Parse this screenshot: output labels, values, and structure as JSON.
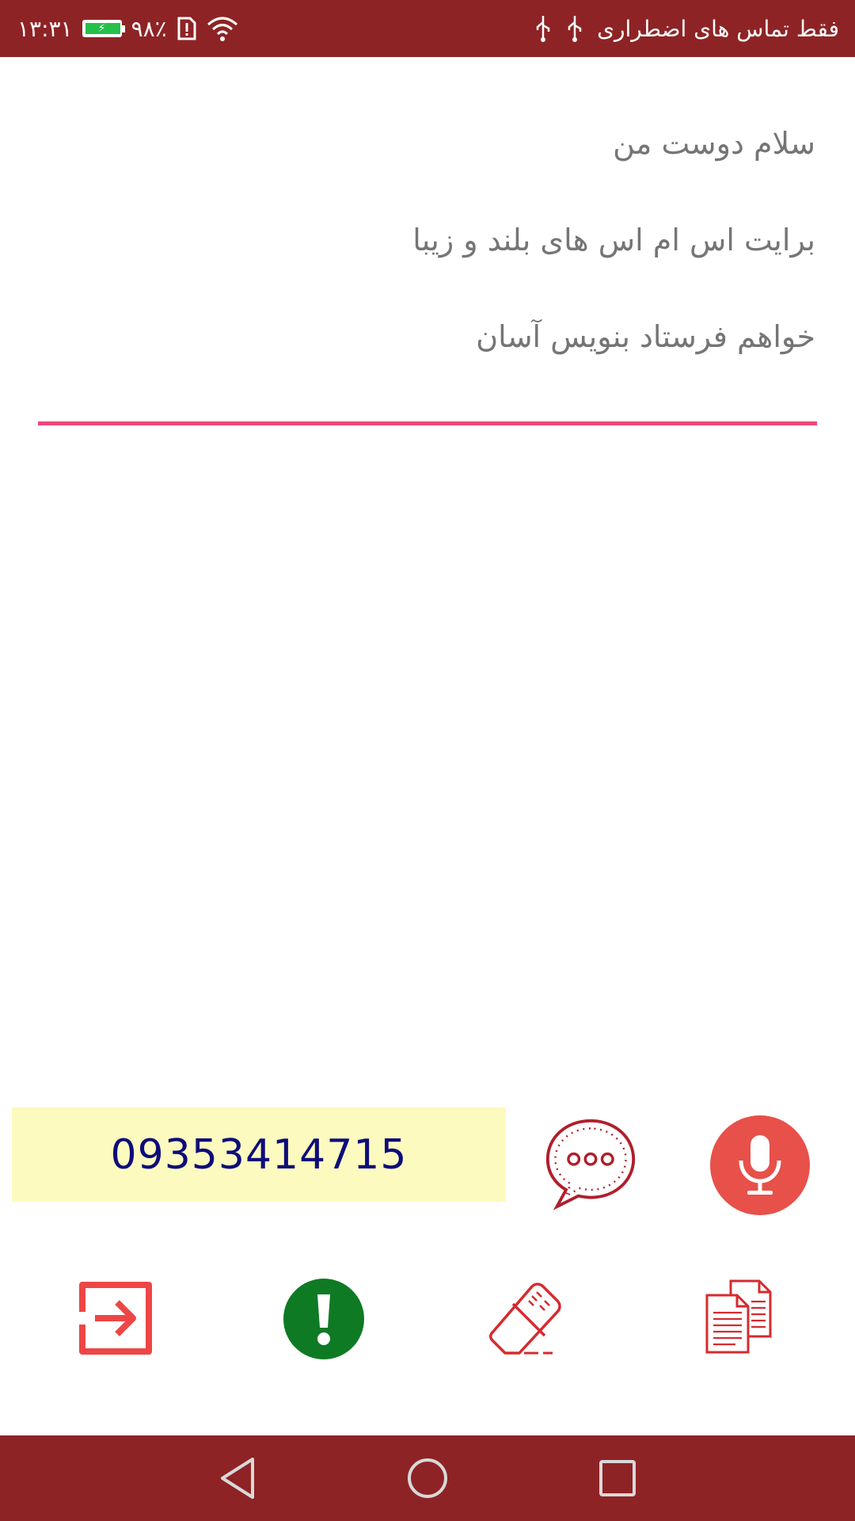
{
  "status_bar": {
    "time": "۱۳:۳۱",
    "battery_percent": "۹۸٪",
    "battery_level": 0.98,
    "carrier_text": "فقط تماس های اضطراری",
    "battery_color": "#24c04a"
  },
  "message": {
    "text": "سلام دوست من\n برایت اس ام اس های بلند و زیبا\nخواهم فرستاد  بنویس آسان"
  },
  "phone": {
    "number": "09353414715"
  },
  "icons": {
    "mic": "microphone-icon",
    "chat": "chat-bubble-icon",
    "copy": "copy-documents-icon",
    "eraser": "eraser-icon",
    "alert": "exclamation-icon",
    "exit": "exit-icon",
    "nav_back": "back-triangle-icon",
    "nav_home": "home-circle-icon",
    "nav_recent": "recent-square-icon"
  },
  "colors": {
    "bar": "#8e2325",
    "accent": "#f0467c",
    "mic_bg": "#e8504a",
    "alert_bg": "#0e7a24",
    "phone_bg": "#fdfabf",
    "phone_text": "#0d0d7a"
  }
}
